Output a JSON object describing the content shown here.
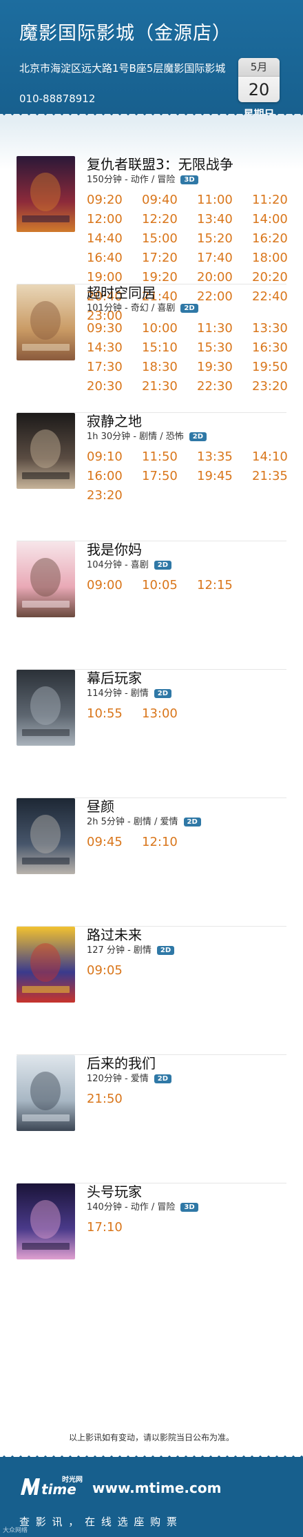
{
  "header": {
    "cinema_name": "魔影国际影城（金源店）",
    "address": "北京市海淀区远大路1号B座5层魔影国际影城",
    "phone": "010-88878912",
    "date": {
      "month": "5月",
      "day": "20",
      "weekday": "星期日"
    }
  },
  "films": [
    {
      "title": "复仇者联盟3：无限战争",
      "meta": "150分钟 - 动作 / 冒险",
      "format": "3D",
      "poster_colors": [
        "#2a1838",
        "#8c2a3a",
        "#d07a2c"
      ],
      "times": [
        "09:20",
        "09:40",
        "11:00",
        "11:20",
        "12:00",
        "12:20",
        "13:40",
        "14:00",
        "14:40",
        "15:00",
        "15:20",
        "16:20",
        "16:40",
        "17:20",
        "17:40",
        "18:00",
        "19:00",
        "19:20",
        "20:00",
        "20:20",
        "20:40",
        "21:40",
        "22:00",
        "22:40",
        "23:00"
      ]
    },
    {
      "title": "超时空同居",
      "meta": "101分钟 - 奇幻 / 喜剧",
      "format": "2D",
      "poster_colors": [
        "#e9d7b9",
        "#c99a64",
        "#8a5a3c"
      ],
      "times": [
        "09:30",
        "10:00",
        "11:30",
        "13:30",
        "14:30",
        "15:10",
        "15:30",
        "16:30",
        "17:30",
        "18:30",
        "19:30",
        "19:50",
        "20:30",
        "21:30",
        "22:30",
        "23:20"
      ]
    },
    {
      "title": "寂静之地",
      "meta": "1h 30分钟 - 剧情 / 恐怖",
      "format": "2D",
      "poster_colors": [
        "#1c1a19",
        "#5a4c42",
        "#c7b49a"
      ],
      "times": [
        "09:10",
        "11:50",
        "13:35",
        "14:10",
        "16:00",
        "17:50",
        "19:45",
        "21:35",
        "23:20"
      ]
    },
    {
      "title": "我是你妈",
      "meta": "104分钟 - 喜剧",
      "format": "2D",
      "poster_colors": [
        "#f7e6ea",
        "#e9a9b6",
        "#6b4a3e"
      ],
      "times": [
        "09:00",
        "10:05",
        "12:15"
      ]
    },
    {
      "title": "幕后玩家",
      "meta": "114分钟 - 剧情",
      "format": "2D",
      "poster_colors": [
        "#2b3138",
        "#5d6670",
        "#a9b2bb"
      ],
      "times": [
        "10:55",
        "13:00"
      ]
    },
    {
      "title": "昼颜",
      "meta": "2h 5分钟 - 剧情 / 爱情",
      "format": "2D",
      "poster_colors": [
        "#1d2734",
        "#46556a",
        "#b9b3ac"
      ],
      "times": [
        "09:45",
        "12:10"
      ]
    },
    {
      "title": "路过未来",
      "meta": "127 分钟 - 剧情",
      "format": "2D",
      "poster_colors": [
        "#f2c230",
        "#3a3a8c",
        "#c8342c"
      ],
      "times": [
        "09:05"
      ]
    },
    {
      "title": "后来的我们",
      "meta": "120分钟 - 爱情",
      "format": "2D",
      "poster_colors": [
        "#dfe6ec",
        "#a8b7c4",
        "#3c4654"
      ],
      "times": [
        "21:50"
      ]
    },
    {
      "title": "头号玩家",
      "meta": "140分钟 - 动作 / 冒险",
      "format": "3D",
      "poster_colors": [
        "#1a1438",
        "#4a3a8a",
        "#e0a0d0"
      ],
      "times": [
        "17:10"
      ]
    }
  ],
  "notice": "以上影讯如有变动，请以影院当日公布为准。",
  "footer": {
    "logo_text": "时光网",
    "url": "www.mtime.com",
    "slogan": "查 影 讯 ， 在 线 选 座 购 票",
    "watermark": "大众网络"
  },
  "colors": {
    "header_bg": "#1d6d9f",
    "time_orange": "#d9761b",
    "badge_blue": "#2f78a6"
  }
}
